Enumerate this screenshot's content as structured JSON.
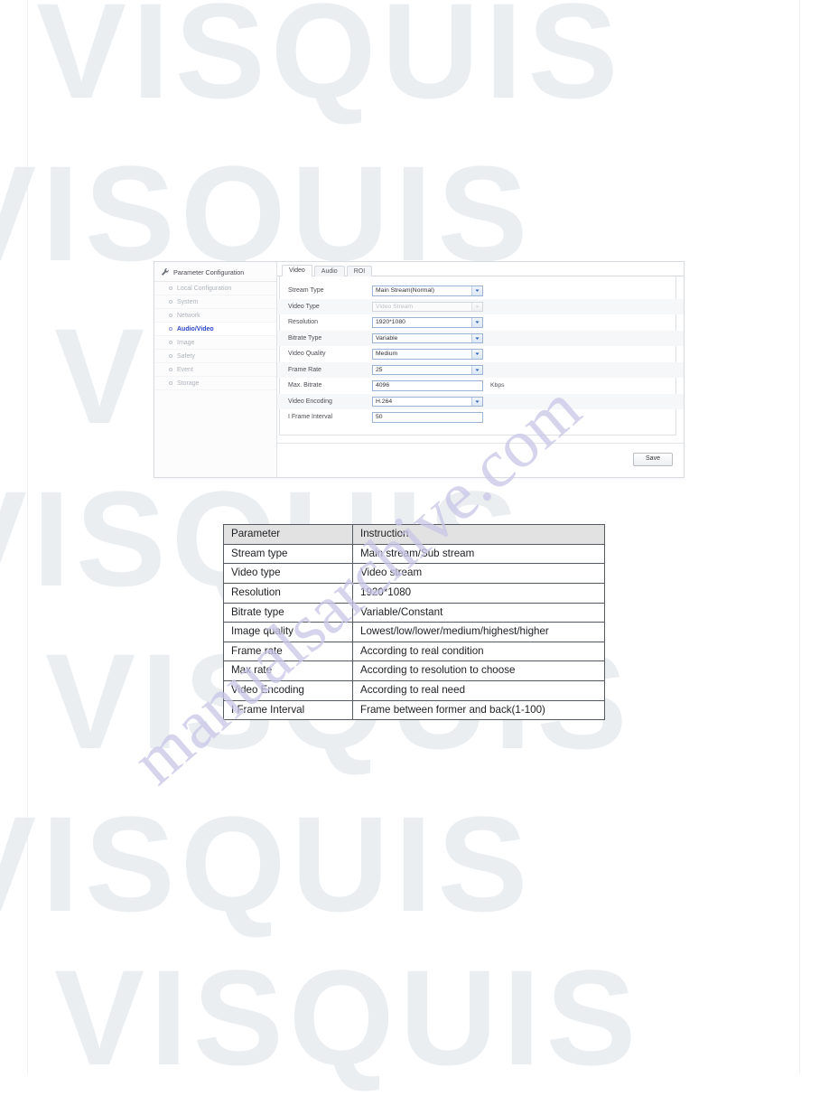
{
  "watermark": {
    "background_text": "VISQUIS",
    "site_text": "manualsarchive.com",
    "background_color": "#e8ecef",
    "site_color": "#c9c6e8"
  },
  "ui_panel": {
    "sidebar": {
      "header": "Parameter Configuration",
      "header_icon": "wrench-icon",
      "items": [
        {
          "label": "Local Configuration",
          "active": false
        },
        {
          "label": "System",
          "active": false
        },
        {
          "label": "Network",
          "active": false
        },
        {
          "label": "Audio/Video",
          "active": true
        },
        {
          "label": "Image",
          "active": false
        },
        {
          "label": "Safety",
          "active": false
        },
        {
          "label": "Event",
          "active": false
        },
        {
          "label": "Storage",
          "active": false
        }
      ],
      "active_color": "#2c46c8"
    },
    "tabs": [
      {
        "label": "Video",
        "active": true
      },
      {
        "label": "Audio",
        "active": false
      },
      {
        "label": "ROI",
        "active": false
      }
    ],
    "form": {
      "rows": [
        {
          "label": "Stream Type",
          "value": "Main Stream(Normal)",
          "control": "select",
          "disabled": false,
          "unit": ""
        },
        {
          "label": "Video Type",
          "value": "Video Stream",
          "control": "select",
          "disabled": true,
          "unit": ""
        },
        {
          "label": "Resolution",
          "value": "1920*1080",
          "control": "select",
          "disabled": false,
          "unit": ""
        },
        {
          "label": "Bitrate Type",
          "value": "Variable",
          "control": "select",
          "disabled": false,
          "unit": ""
        },
        {
          "label": "Video Quality",
          "value": "Medium",
          "control": "select",
          "disabled": false,
          "unit": ""
        },
        {
          "label": "Frame Rate",
          "value": "25",
          "control": "select",
          "disabled": false,
          "unit": ""
        },
        {
          "label": "Max. Bitrate",
          "value": "4096",
          "control": "text",
          "disabled": false,
          "unit": "Kbps"
        },
        {
          "label": "Video Encoding",
          "value": "H.264",
          "control": "select",
          "disabled": false,
          "unit": ""
        },
        {
          "label": "I Frame Interval",
          "value": "50",
          "control": "text",
          "disabled": false,
          "unit": ""
        }
      ]
    },
    "footer": {
      "save_label": "Save"
    }
  },
  "instruction_table": {
    "headers": [
      "Parameter",
      "Instruction"
    ],
    "rows": [
      [
        "Stream type",
        "Main stream/Sub stream"
      ],
      [
        "Video type",
        "Video stream"
      ],
      [
        "Resolution",
        "1920*1080"
      ],
      [
        "Bitrate type",
        "Variable/Constant"
      ],
      [
        "Image quality",
        "Lowest/low/lower/medium/highest/higher"
      ],
      [
        "Frame rate",
        "According to real condition"
      ],
      [
        "Max rate",
        "According to resolution to choose"
      ],
      [
        "Video Encoding",
        "According to real need"
      ],
      [
        "I Frame Interval",
        "Frame between former and back(1-100)"
      ]
    ]
  }
}
